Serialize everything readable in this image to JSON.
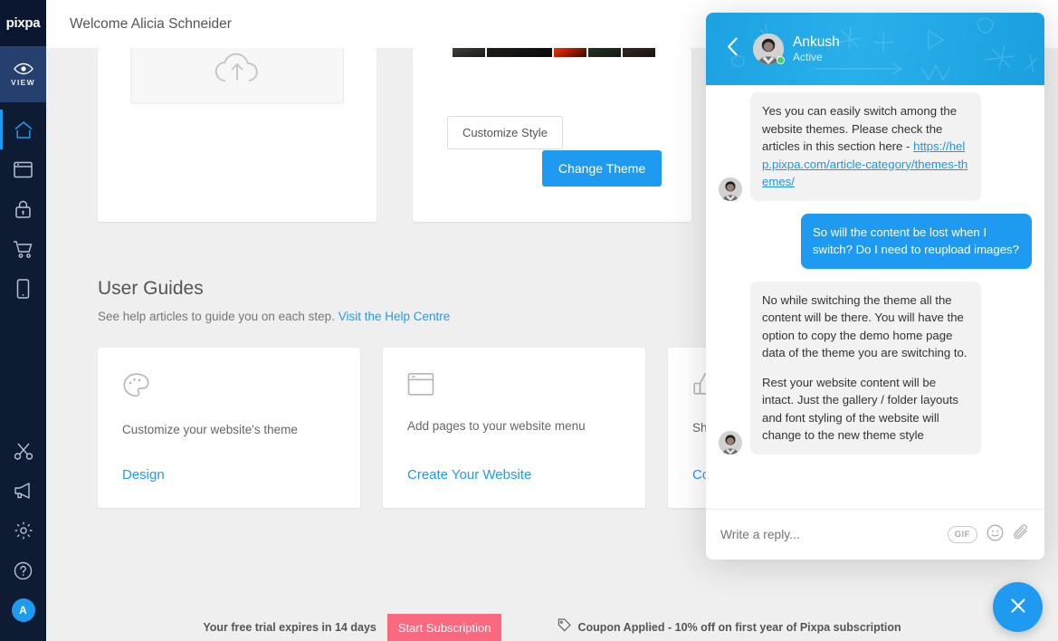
{
  "sidebar": {
    "brand": "pixpa",
    "view_label": "VIEW",
    "view_icon": "eye-icon",
    "items": [
      {
        "name": "home",
        "icon": "home-icon",
        "active": true
      },
      {
        "name": "pages",
        "icon": "window-icon",
        "active": false
      },
      {
        "name": "client-galleries",
        "icon": "lock-icon",
        "active": false
      },
      {
        "name": "store",
        "icon": "cart-icon",
        "active": false
      },
      {
        "name": "mobile",
        "icon": "mobile-icon",
        "active": false
      }
    ],
    "bottom_items": [
      {
        "name": "design",
        "icon": "scissors-icon"
      },
      {
        "name": "marketing",
        "icon": "megaphone-icon"
      },
      {
        "name": "settings",
        "icon": "gear-icon"
      },
      {
        "name": "help",
        "icon": "question-circle-icon"
      }
    ],
    "avatar_initial": "A"
  },
  "header": {
    "title": "Welcome Alicia Schneider"
  },
  "cards": {
    "upload": {
      "icon": "cloud-upload-icon"
    },
    "theme": {
      "customize_label": "Customize Style",
      "change_label": "Change Theme"
    }
  },
  "guides": {
    "title": "User Guides",
    "subtitle": "See help articles to guide you on each step.",
    "help_link": "Visit the Help Centre",
    "items": [
      {
        "icon": "palette-icon",
        "label": "Customize your website's theme",
        "link": "Design"
      },
      {
        "icon": "window-icon",
        "label": "Add pages to your website menu",
        "link": "Create Your Website"
      },
      {
        "icon": "thumbs-up-icon",
        "label": "Share your website",
        "link": "Connect"
      }
    ]
  },
  "bottom_bar": {
    "trial_text": "Your free trial expires in 14 days",
    "subscribe_label": "Start Subscription",
    "coupon_icon": "tag-icon",
    "coupon_text": "Coupon Applied - 10% off on first year of Pixpa subscription"
  },
  "chat": {
    "back_icon": "chevron-left-icon",
    "agent_name": "Ankush",
    "agent_status": "Active",
    "messages": [
      {
        "direction": "in",
        "text": "Yes you can easily switch among the website themes. Please check the articles in this section here - ",
        "link": "https://help.pixpa.com/article-category/themes-themes/"
      },
      {
        "direction": "out",
        "text": "So will the content be lost when I switch? Do I need to reupload images?"
      },
      {
        "direction": "in",
        "paragraph1": "No while switching the theme all the content will be there. You will have the option to copy the demo home page data of the theme you are switching to.",
        "paragraph2": "Rest your website content will be intact. Just the gallery / folder layouts and font styling of the website will change to the new theme style"
      }
    ],
    "composer_placeholder": "Write a reply...",
    "gif_label": "GIF",
    "emoji_icon": "smiley-icon",
    "attach_icon": "paperclip-icon"
  },
  "fab": {
    "icon": "close-icon"
  },
  "colors": {
    "accent_blue": "#1e9bf0",
    "sidebar_dark": "#0d1b33",
    "sidebar_view": "#25406e",
    "subscribe_pink": "#f9697f",
    "page_bg": "#efefef"
  }
}
